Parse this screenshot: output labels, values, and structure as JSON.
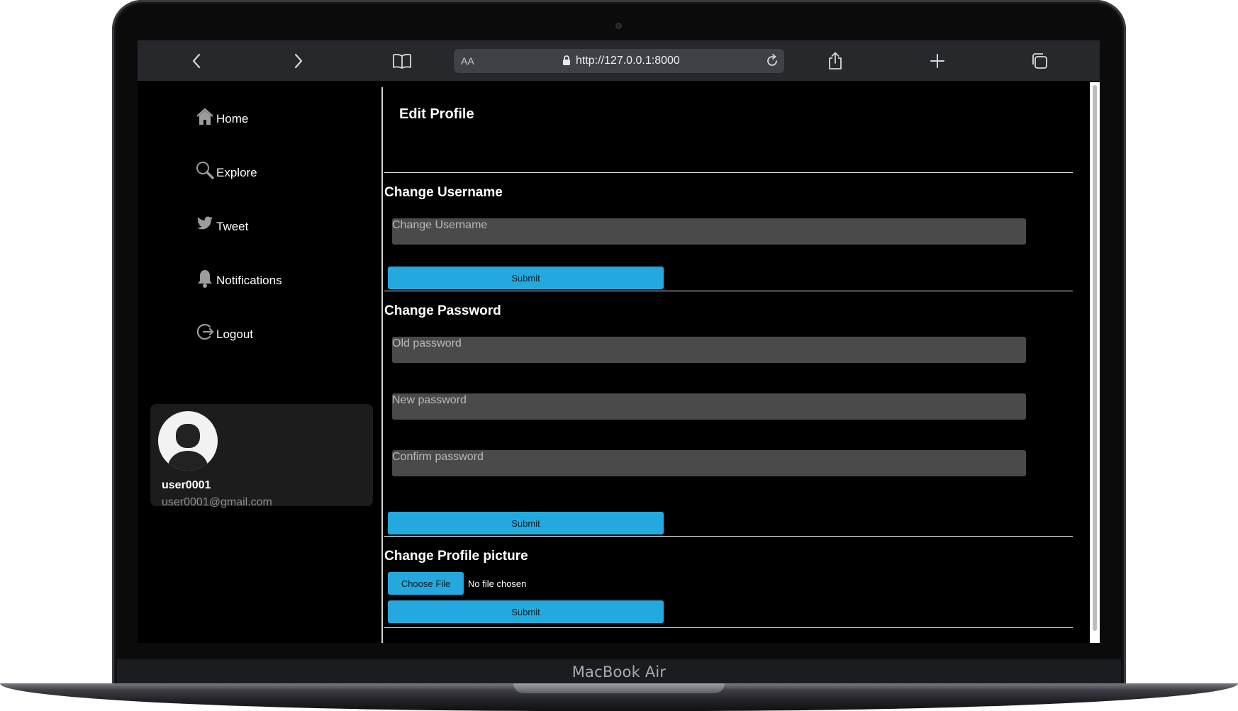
{
  "device": {
    "brand_label": "MacBook Air"
  },
  "browser": {
    "aa_label": "AA",
    "url": "http://127.0.0.1:8000",
    "buttons": [
      "back",
      "forward",
      "bookmarks",
      "reader-aa",
      "reload",
      "share",
      "new-tab",
      "tabs-overview"
    ]
  },
  "sidebar": {
    "items": [
      {
        "label": "Home",
        "icon": "home-icon"
      },
      {
        "label": "Explore",
        "icon": "search-icon"
      },
      {
        "label": "Tweet",
        "icon": "bird-icon"
      },
      {
        "label": "Notifications",
        "icon": "bell-icon"
      },
      {
        "label": "Logout",
        "icon": "logout-icon"
      }
    ],
    "profile": {
      "username": "user0001",
      "email": "user0001@gmail.com"
    }
  },
  "main": {
    "title": "Edit Profile",
    "username_section": {
      "title": "Change Username",
      "placeholder": "Change Username",
      "submit_label": "Submit"
    },
    "password_section": {
      "title": "Change Password",
      "old_placeholder": "Old password",
      "new_placeholder": "New password",
      "confirm_placeholder": "Confirm password",
      "submit_label": "Submit"
    },
    "picture_section": {
      "title": "Change Profile picture",
      "choose_label": "Choose File",
      "file_status": "No file chosen",
      "submit_label": "Submit"
    }
  },
  "colors": {
    "accent": "#23a9de",
    "background": "#000000",
    "input_bg": "#4a4a4a",
    "card_bg": "#1c1c1c"
  }
}
